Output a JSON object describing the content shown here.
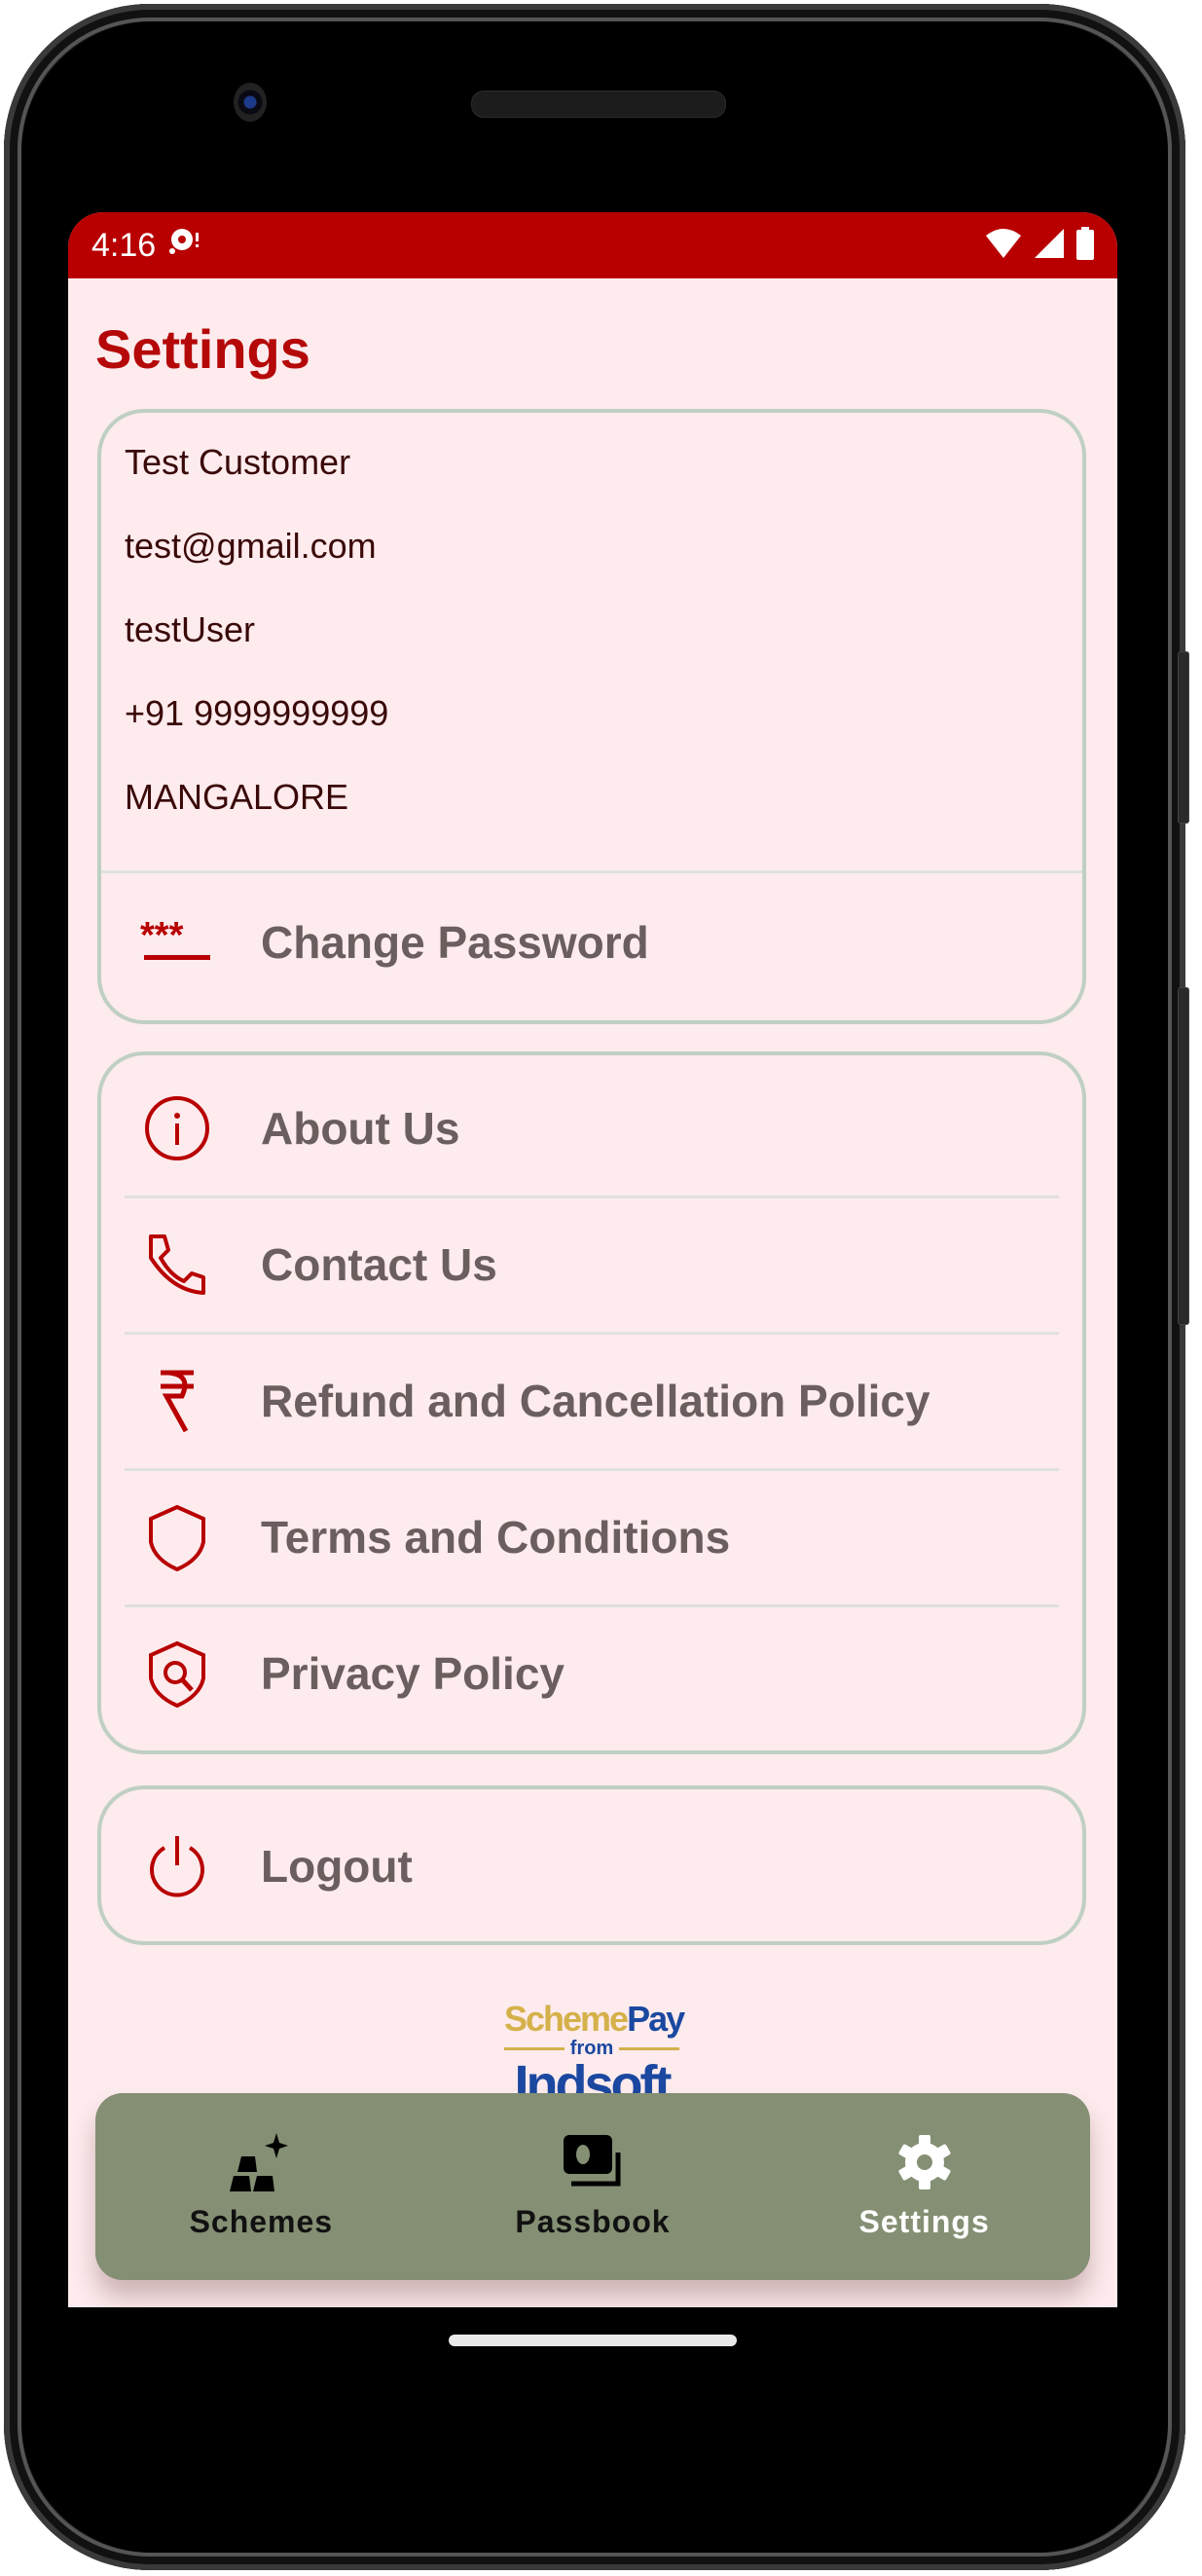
{
  "status_bar": {
    "time": "4:16",
    "icons": [
      "notification-icon",
      "wifi-icon",
      "signal-icon",
      "battery-icon"
    ]
  },
  "header": {
    "title": "Settings"
  },
  "profile": {
    "name": "Test Customer",
    "email": "test@gmail.com",
    "username": "testUser",
    "phone": "+91 9999999999",
    "city": "MANGALORE",
    "change_password": {
      "label": "Change Password",
      "icon": "password-asterisks-icon"
    }
  },
  "info_menu": [
    {
      "label": "About Us",
      "icon": "info-icon"
    },
    {
      "label": "Contact Us",
      "icon": "phone-icon"
    },
    {
      "label": "Refund and Cancellation Policy",
      "icon": "rupee-icon"
    },
    {
      "label": "Terms and Conditions",
      "icon": "shield-icon"
    },
    {
      "label": "Privacy Policy",
      "icon": "shield-search-icon"
    }
  ],
  "logout": {
    "label": "Logout",
    "icon": "power-icon"
  },
  "branding": {
    "scheme": "Scheme",
    "pay": "Pay",
    "from": "from",
    "company": "Indsoft"
  },
  "bottom_nav": {
    "items": [
      {
        "label": "Schemes",
        "icon": "gold-bars-icon",
        "active": false
      },
      {
        "label": "Passbook",
        "icon": "passbook-icon",
        "active": false
      },
      {
        "label": "Settings",
        "icon": "gear-icon",
        "active": true
      }
    ]
  },
  "colors": {
    "primary": "#b80000",
    "background": "#fdebed",
    "card_border": "#bfcfc4",
    "nav_background": "#848f74",
    "menu_text": "#6b5e5e",
    "profile_text": "#3a0808"
  }
}
